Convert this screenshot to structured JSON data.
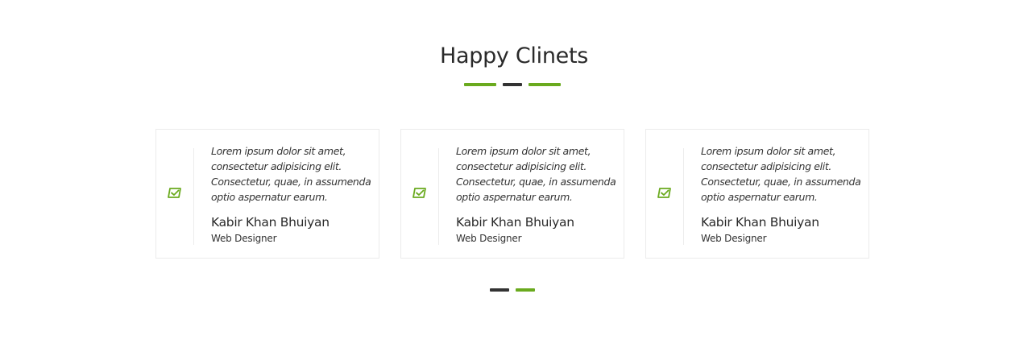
{
  "section": {
    "title": "Happy Clinets"
  },
  "colors": {
    "accent": "#6aaa1e",
    "dark": "#333333",
    "card_border": "#ececec"
  },
  "testimonials": [
    {
      "quote": "Lorem ipsum dolor sit amet, consectetur adipisicing elit. Consectetur, quae, in assumenda optio aspernatur earum.",
      "name": "Kabir Khan Bhuiyan",
      "role": "Web Designer",
      "icon": "check-square-icon"
    },
    {
      "quote": "Lorem ipsum dolor sit amet, consectetur adipisicing elit. Consectetur, quae, in assumenda optio aspernatur earum.",
      "name": "Kabir Khan Bhuiyan",
      "role": "Web Designer",
      "icon": "check-square-icon"
    },
    {
      "quote": "Lorem ipsum dolor sit amet, consectetur adipisicing elit. Consectetur, quae, in assumenda optio aspernatur earum.",
      "name": "Kabir Khan Bhuiyan",
      "role": "Web Designer",
      "icon": "check-square-icon"
    }
  ],
  "pager": {
    "pages": 2,
    "active_index": 1
  }
}
